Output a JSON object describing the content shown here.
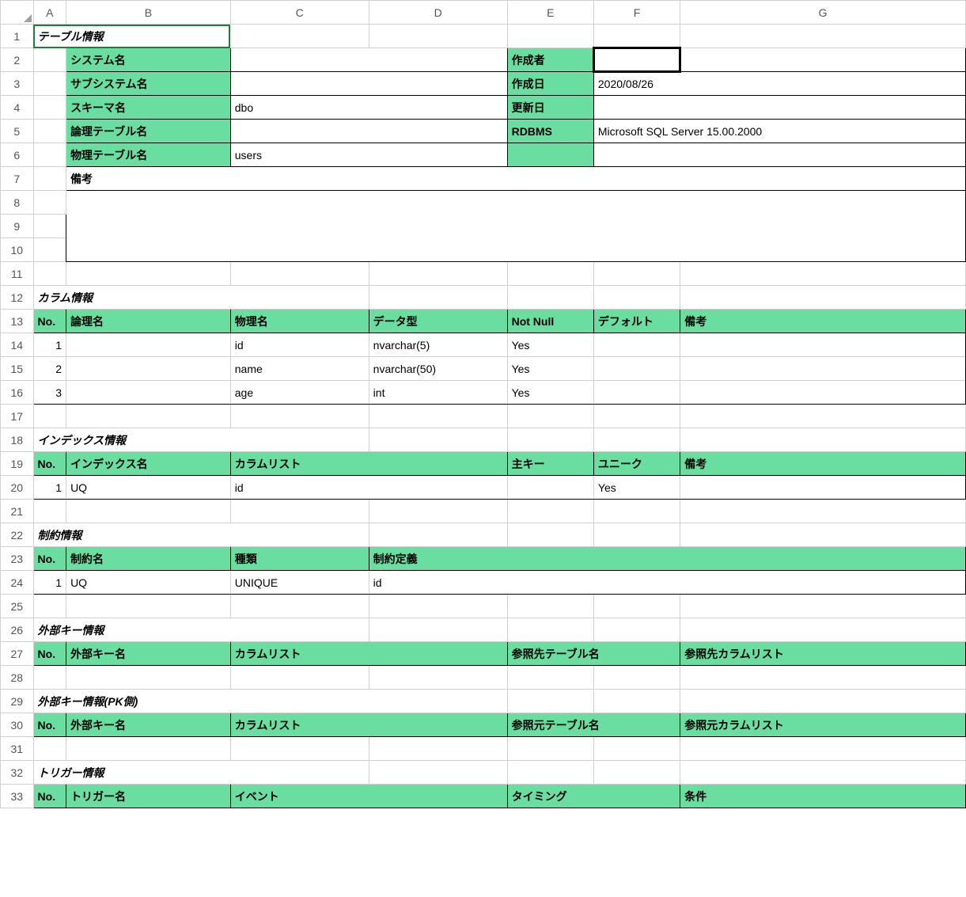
{
  "cols": [
    "A",
    "B",
    "C",
    "D",
    "E",
    "F",
    "G"
  ],
  "section_titles": {
    "table_info": "テーブル情報",
    "column_info": "カラム情報",
    "index_info": "インデックス情報",
    "constraint_info": "制約情報",
    "fk_info": "外部キー情報",
    "fk_pk_info": "外部キー情報(PK側)",
    "trigger_info": "トリガー情報"
  },
  "table_info": {
    "labels": {
      "system_name": "システム名",
      "subsystem_name": "サブシステム名",
      "schema_name": "スキーマ名",
      "logical_table_name": "論理テーブル名",
      "physical_table_name": "物理テーブル名",
      "author": "作成者",
      "created": "作成日",
      "updated": "更新日",
      "rdbms": "RDBMS",
      "remarks": "備考"
    },
    "values": {
      "system_name": "",
      "subsystem_name": "",
      "schema_name": "dbo",
      "logical_table_name": "",
      "physical_table_name": "users",
      "author": "",
      "created": "2020/08/26",
      "updated": "",
      "rdbms": "Microsoft SQL Server 15.00.2000",
      "remarks": ""
    }
  },
  "column_headers": {
    "no": "No.",
    "logical": "論理名",
    "physical": "物理名",
    "datatype": "データ型",
    "notnull": "Not Null",
    "default": "デフォルト",
    "remarks": "備考"
  },
  "columns": [
    {
      "no": "1",
      "logical": "",
      "physical": "id",
      "datatype": "nvarchar(5)",
      "notnull": "Yes",
      "default": "",
      "remarks": ""
    },
    {
      "no": "2",
      "logical": "",
      "physical": "name",
      "datatype": "nvarchar(50)",
      "notnull": "Yes",
      "default": "",
      "remarks": ""
    },
    {
      "no": "3",
      "logical": "",
      "physical": "age",
      "datatype": "int",
      "notnull": "Yes",
      "default": "",
      "remarks": ""
    }
  ],
  "index_headers": {
    "no": "No.",
    "name": "インデックス名",
    "cols": "カラムリスト",
    "pk": "主キー",
    "uq": "ユニーク",
    "remarks": "備考"
  },
  "indexes": [
    {
      "no": "1",
      "name": "UQ",
      "cols": "id",
      "pk": "",
      "uq": "Yes",
      "remarks": ""
    }
  ],
  "constraint_headers": {
    "no": "No.",
    "name": "制約名",
    "type": "種類",
    "def": "制約定義"
  },
  "constraints": [
    {
      "no": "1",
      "name": "UQ",
      "type": "UNIQUE",
      "def": "id"
    }
  ],
  "fk_headers": {
    "no": "No.",
    "name": "外部キー名",
    "cols": "カラムリスト",
    "ref_table": "参照先テーブル名",
    "ref_cols": "参照先カラムリスト"
  },
  "fk_pk_headers": {
    "no": "No.",
    "name": "外部キー名",
    "cols": "カラムリスト",
    "ref_table": "参照元テーブル名",
    "ref_cols": "参照元カラムリスト"
  },
  "trigger_headers": {
    "no": "No.",
    "name": "トリガー名",
    "event": "イベント",
    "timing": "タイミング",
    "cond": "条件"
  }
}
